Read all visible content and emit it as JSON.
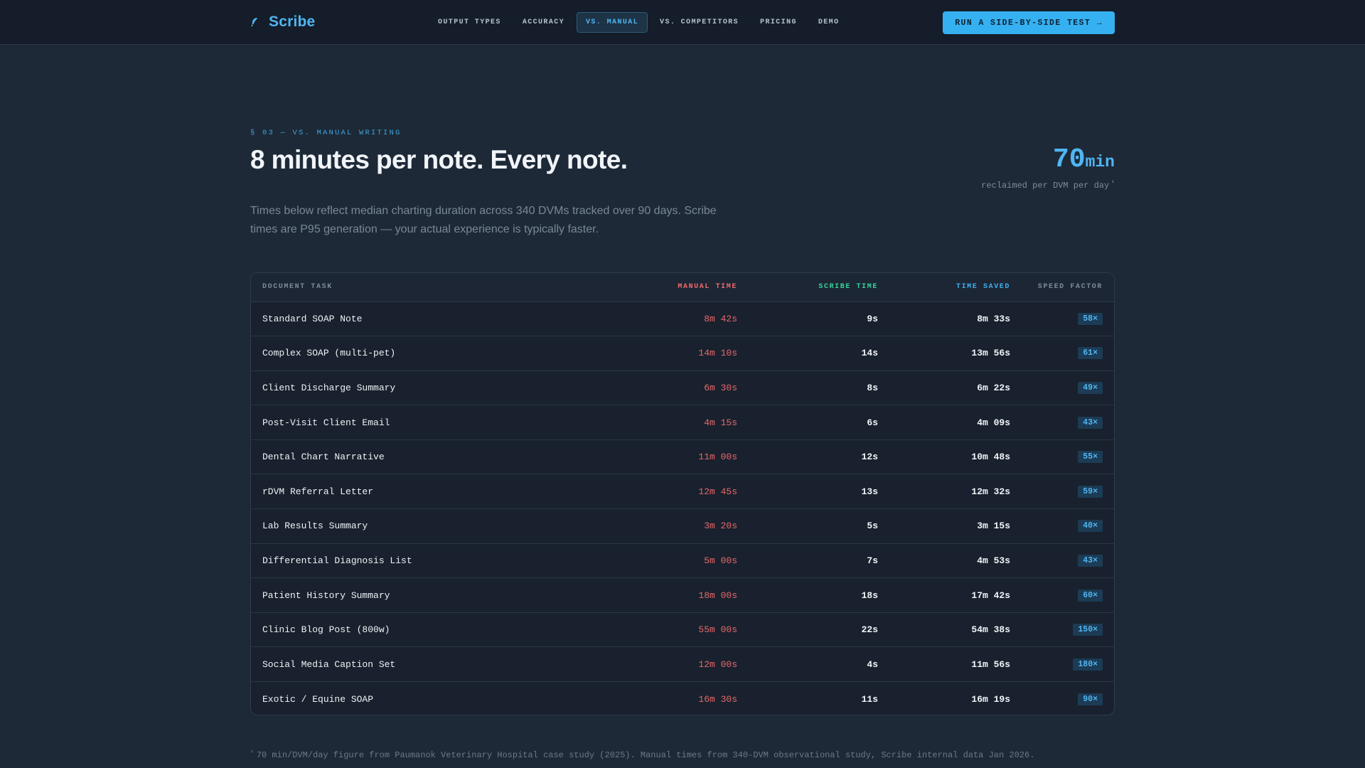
{
  "nav": {
    "brand": "Scribe",
    "links": [
      {
        "label": "OUTPUT TYPES",
        "active": false
      },
      {
        "label": "ACCURACY",
        "active": false
      },
      {
        "label": "VS. MANUAL",
        "active": true
      },
      {
        "label": "VS. COMPETITORS",
        "active": false
      },
      {
        "label": "PRICING",
        "active": false
      },
      {
        "label": "DEMO",
        "active": false
      }
    ],
    "cta": "RUN A SIDE-BY-SIDE TEST →"
  },
  "section": {
    "eyebrow": "§ 03 — VS. MANUAL WRITING",
    "title": "8 minutes per note. Every note.",
    "stat_value": "70",
    "stat_unit": "min",
    "stat_caption": "reclaimed per DVM per day",
    "stat_marker": "¹",
    "lede": "Times below reflect median charting duration across 340 DVMs tracked over 90 days. Scribe times are P95 generation — your actual experience is typically faster."
  },
  "table": {
    "headers": {
      "task": "DOCUMENT TASK",
      "manual": "MANUAL TIME",
      "scribe": "SCRIBE TIME",
      "saved": "TIME SAVED",
      "speed": "SPEED FACTOR"
    },
    "rows": [
      {
        "task": "Standard SOAP Note",
        "manual": "8m 42s",
        "scribe": "9s",
        "saved": "8m 33s",
        "speed": "58×"
      },
      {
        "task": "Complex SOAP (multi-pet)",
        "manual": "14m 10s",
        "scribe": "14s",
        "saved": "13m 56s",
        "speed": "61×"
      },
      {
        "task": "Client Discharge Summary",
        "manual": "6m 30s",
        "scribe": "8s",
        "saved": "6m 22s",
        "speed": "49×"
      },
      {
        "task": "Post-Visit Client Email",
        "manual": "4m 15s",
        "scribe": "6s",
        "saved": "4m 09s",
        "speed": "43×"
      },
      {
        "task": "Dental Chart Narrative",
        "manual": "11m 00s",
        "scribe": "12s",
        "saved": "10m 48s",
        "speed": "55×"
      },
      {
        "task": "rDVM Referral Letter",
        "manual": "12m 45s",
        "scribe": "13s",
        "saved": "12m 32s",
        "speed": "59×"
      },
      {
        "task": "Lab Results Summary",
        "manual": "3m 20s",
        "scribe": "5s",
        "saved": "3m 15s",
        "speed": "40×"
      },
      {
        "task": "Differential Diagnosis List",
        "manual": "5m 00s",
        "scribe": "7s",
        "saved": "4m 53s",
        "speed": "43×"
      },
      {
        "task": "Patient History Summary",
        "manual": "18m 00s",
        "scribe": "18s",
        "saved": "17m 42s",
        "speed": "60×"
      },
      {
        "task": "Clinic Blog Post (800w)",
        "manual": "55m 00s",
        "scribe": "22s",
        "saved": "54m 38s",
        "speed": "150×"
      },
      {
        "task": "Social Media Caption Set",
        "manual": "12m 00s",
        "scribe": "4s",
        "saved": "11m 56s",
        "speed": "180×"
      },
      {
        "task": "Exotic / Equine SOAP",
        "manual": "16m 30s",
        "scribe": "11s",
        "saved": "16m 19s",
        "speed": "90×"
      }
    ]
  },
  "footnote": {
    "marker": "¹",
    "text": "70 min/DVM/day figure from Paumanok Veterinary Hospital case study (2025). Manual times from 340-DVM observational study, Scribe internal data Jan 2026."
  },
  "icons": {
    "logo": "feather-icon"
  },
  "colors": {
    "accent": "#4fb6f2",
    "manual": "#e8676a",
    "scribe": "#37d39a",
    "background": "#1d2937"
  }
}
